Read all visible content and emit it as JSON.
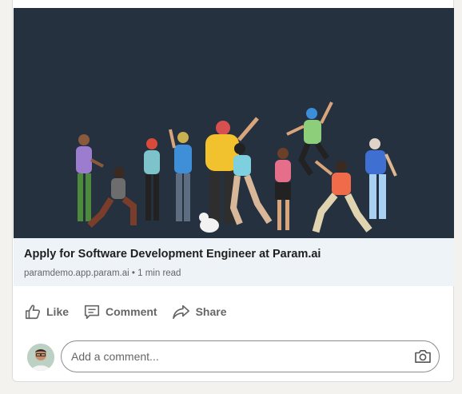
{
  "post": {
    "link_title": "Apply for Software Development Engineer at Param.ai",
    "link_domain": "paramdemo.app.param.ai",
    "link_separator": "•",
    "link_read_time": "1 min read"
  },
  "actions": {
    "like_label": "Like",
    "comment_label": "Comment",
    "share_label": "Share"
  },
  "comment_box": {
    "placeholder": "Add a comment..."
  },
  "icons": {
    "like": "thumbs-up-icon",
    "comment": "comment-icon",
    "share": "share-arrow-icon",
    "camera": "camera-icon"
  },
  "colors": {
    "image_background": "#263140",
    "link_box_background": "#eef3f8",
    "action_text": "#666666"
  }
}
